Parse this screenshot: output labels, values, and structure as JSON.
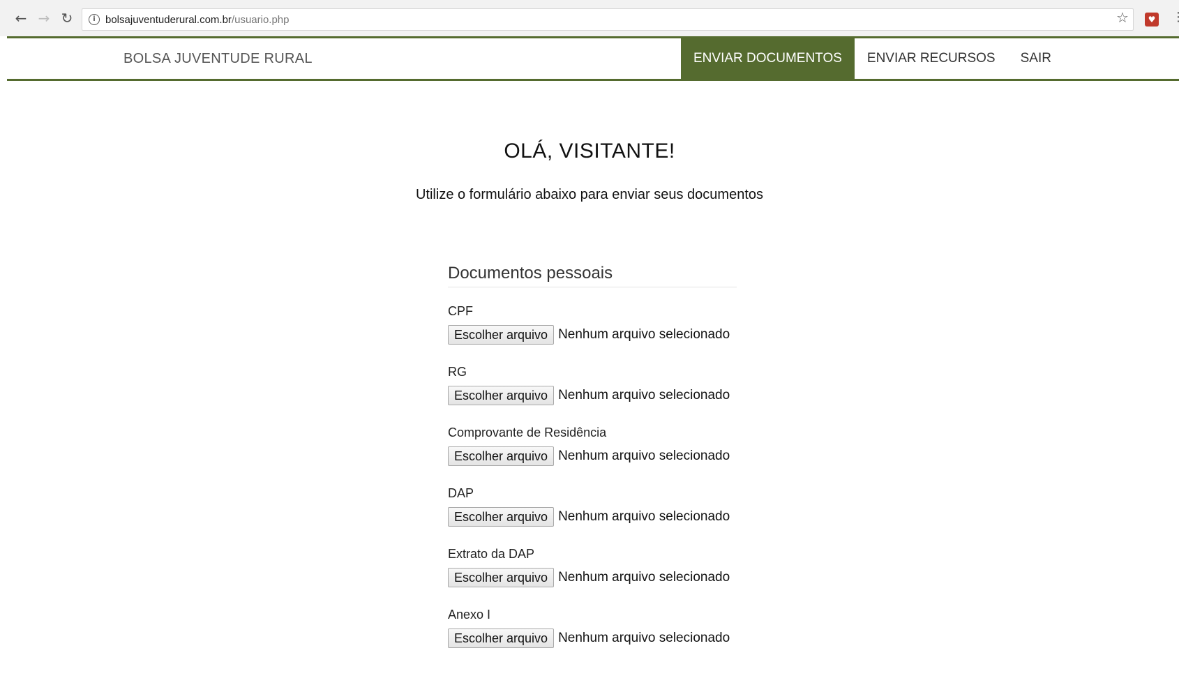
{
  "browser": {
    "url_host": "bolsajuventuderural.com.br",
    "url_path": "/usuario.php"
  },
  "header": {
    "brand": "BOLSA JUVENTUDE RURAL",
    "menu": [
      {
        "label": "ENVIAR DOCUMENTOS",
        "active": true
      },
      {
        "label": "ENVIAR RECURSOS",
        "active": false
      },
      {
        "label": "SAIR",
        "active": false
      }
    ]
  },
  "main": {
    "greeting": "OLÁ, VISITANTE!",
    "subtitle": "Utilize o formulário abaixo para enviar seus documentos",
    "section_title": "Documentos pessoais",
    "fields": [
      {
        "label": "CPF",
        "button": "Escolher arquivo",
        "status": "Nenhum arquivo selecionado"
      },
      {
        "label": "RG",
        "button": "Escolher arquivo",
        "status": "Nenhum arquivo selecionado"
      },
      {
        "label": "Comprovante de Residência",
        "button": "Escolher arquivo",
        "status": "Nenhum arquivo selecionado"
      },
      {
        "label": "DAP",
        "button": "Escolher arquivo",
        "status": "Nenhum arquivo selecionado"
      },
      {
        "label": "Extrato da DAP",
        "button": "Escolher arquivo",
        "status": "Nenhum arquivo selecionado"
      },
      {
        "label": "Anexo I",
        "button": "Escolher arquivo",
        "status": "Nenhum arquivo selecionado"
      }
    ]
  },
  "colors": {
    "accent": "#556b2f"
  }
}
